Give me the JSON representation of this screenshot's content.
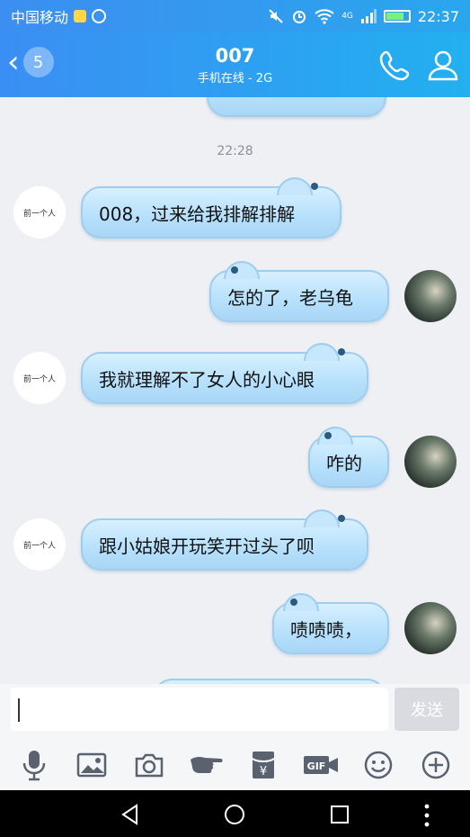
{
  "status_bar": {
    "carrier": "中国移动",
    "network": "4G",
    "time": "22:37"
  },
  "header": {
    "unread_badge": "5",
    "contact_name": "007",
    "contact_status": "手机在线 - 2G"
  },
  "chat": {
    "timestamp": "22:28",
    "friend_avatar_text": "前一个人",
    "messages": [
      {
        "from": "friend",
        "text": "008，过来给我排解排解"
      },
      {
        "from": "me",
        "text": "怎的了，老乌龟"
      },
      {
        "from": "friend",
        "text": "我就理解不了女人的小心眼"
      },
      {
        "from": "me",
        "text": "咋的"
      },
      {
        "from": "friend",
        "text": "跟小姑娘开玩笑开过头了呗"
      },
      {
        "from": "me",
        "text": "啧啧啧，"
      }
    ]
  },
  "input": {
    "value": "",
    "send_label": "发送"
  },
  "toolbar": {
    "icons": [
      "microphone-icon",
      "image-icon",
      "camera-icon",
      "poke-hand-icon",
      "red-packet-icon",
      "gif-icon",
      "emoji-icon",
      "plus-icon"
    ],
    "gif_label": "GIF",
    "red_packet_symbol": "¥"
  },
  "colors": {
    "header_start": "#3b8ef3",
    "header_end": "#22b0f0",
    "bubble": "#b6e0fb",
    "send_disabled": "#d9dbe0"
  }
}
